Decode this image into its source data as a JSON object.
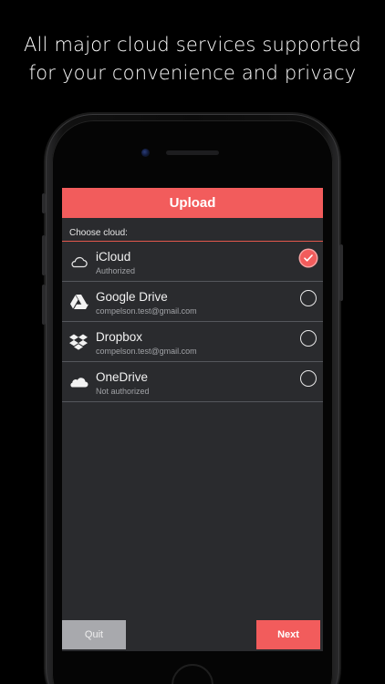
{
  "headline": {
    "line1": "All major cloud services supported",
    "line2": "for your convenience and privacy"
  },
  "screen": {
    "title": "Upload",
    "section_label": "Choose cloud:",
    "accent_color": "#f25c5c",
    "clouds": [
      {
        "name": "iCloud",
        "status": "Authorized",
        "icon": "cloud-icon",
        "selected": true
      },
      {
        "name": "Google Drive",
        "status": "compelson.test@gmail.com",
        "icon": "google-drive-icon",
        "selected": false
      },
      {
        "name": "Dropbox",
        "status": "compelson.test@gmail.com",
        "icon": "dropbox-icon",
        "selected": false
      },
      {
        "name": "OneDrive",
        "status": "Not authorized",
        "icon": "onedrive-icon",
        "selected": false
      }
    ],
    "quit_label": "Quit",
    "next_label": "Next"
  }
}
